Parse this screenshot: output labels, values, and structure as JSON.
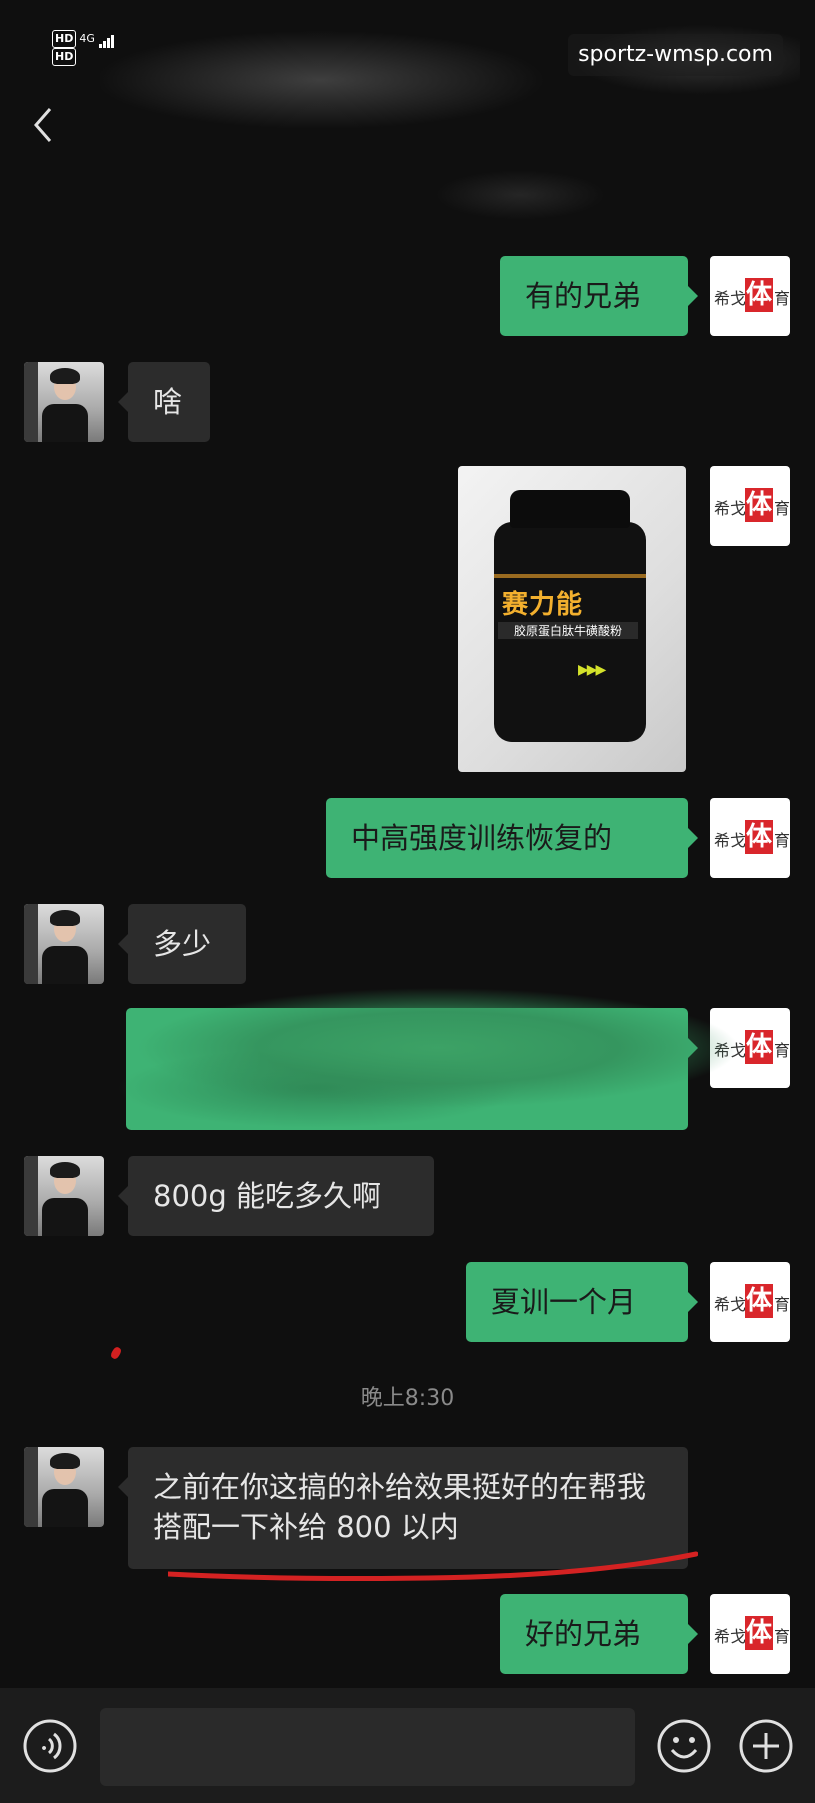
{
  "status_bar": {
    "hd1": "HD",
    "hd2": "HD",
    "network": "4G"
  },
  "watermark": "sportz-wmsp.com",
  "icons": {
    "back": "chevron-left-icon",
    "voice": "voice-icon",
    "emoji": "emoji-icon",
    "add": "plus-icon"
  },
  "avatar_right": {
    "left_char": "希戈",
    "center_char": "体",
    "right_char": "育"
  },
  "product": {
    "brand": "赛力能",
    "name": "胶原蛋白肽牛磺酸粉"
  },
  "messages": [
    {
      "side": "right",
      "text": "有的兄弟"
    },
    {
      "side": "left",
      "text": "啥"
    },
    {
      "side": "right",
      "type": "image"
    },
    {
      "side": "right",
      "text": "中高强度训练恢复的"
    },
    {
      "side": "left",
      "text": "多少"
    },
    {
      "side": "right",
      "type": "redacted"
    },
    {
      "side": "left",
      "text": "800g 能吃多久啊"
    },
    {
      "side": "right",
      "text": "夏训一个月"
    },
    {
      "side": "left",
      "text": "之前在你这搞的补给效果挺好的在帮我搭配一下补给 800 以内"
    },
    {
      "side": "right",
      "text": "好的兄弟"
    }
  ],
  "timestamp": "晚上8:30"
}
